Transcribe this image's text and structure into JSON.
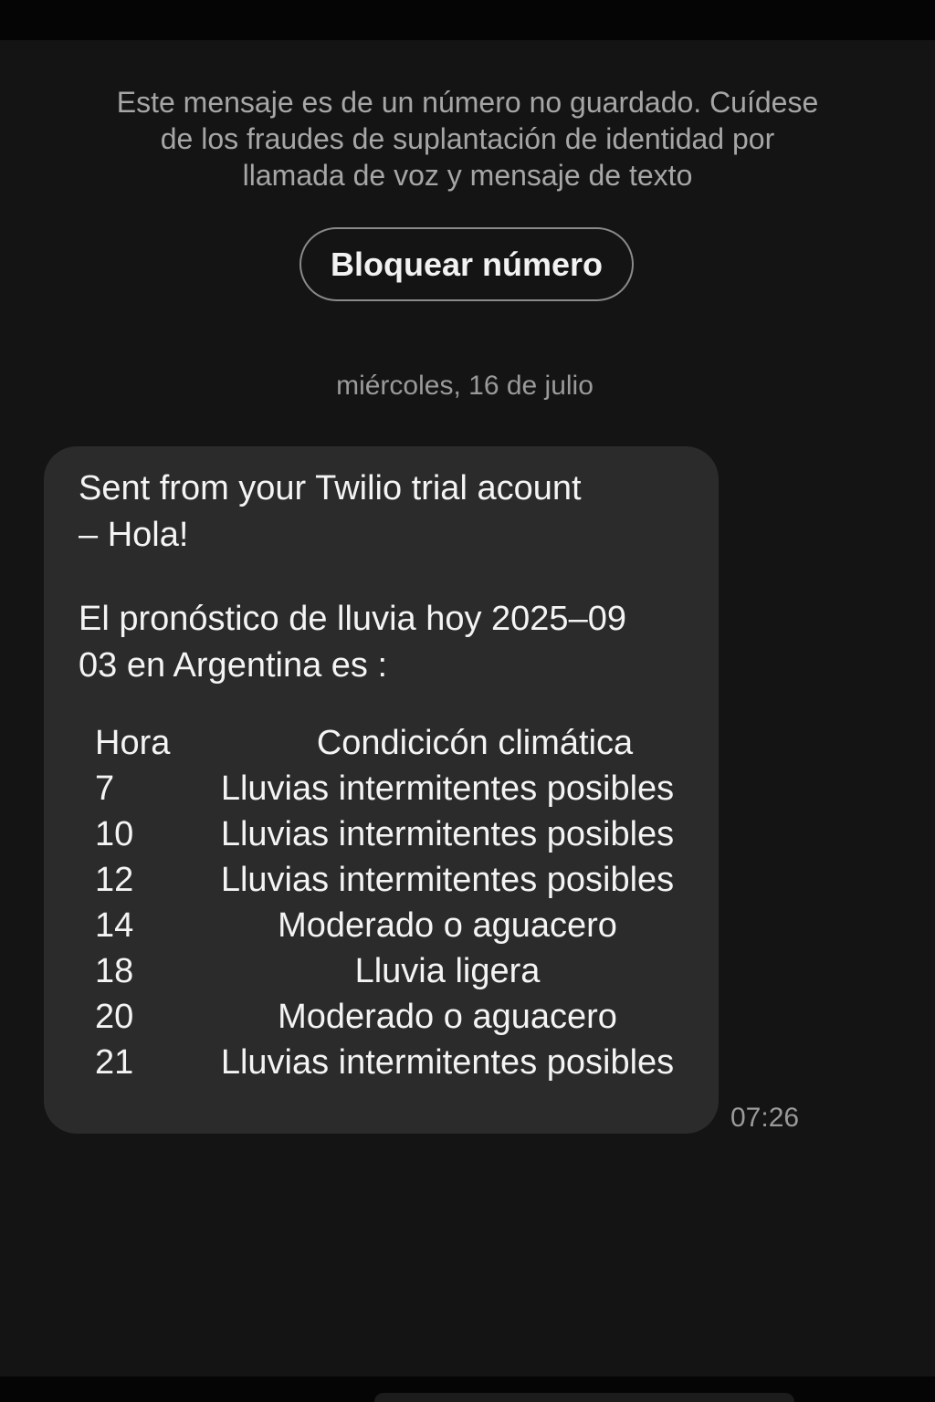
{
  "security_notice": {
    "line1": "Este mensaje es de un número no guardado. Cuídese",
    "line2": "de los fraudes de suplantación de identidad por",
    "line3": "llamada de voz y mensaje de texto"
  },
  "block_button_label": "Bloquear número",
  "date_separator": "miércoles, 16 de julio",
  "message": {
    "line1": "Sent from your Twilio trial acount",
    "line2": "– Hola!",
    "line3": "El pronóstico de lluvia hoy 2025–09",
    "line4": "03 en Argentina es :",
    "table": {
      "header_hour": "Hora",
      "header_condition": "Condicicón climática",
      "rows": [
        {
          "hour": "7",
          "condition": "Lluvias intermitentes posibles"
        },
        {
          "hour": "10",
          "condition": "Lluvias intermitentes posibles"
        },
        {
          "hour": "12",
          "condition": "Lluvias intermitentes posibles"
        },
        {
          "hour": "14",
          "condition": "Moderado o aguacero"
        },
        {
          "hour": "18",
          "condition": "Lluvia ligera"
        },
        {
          "hour": "20",
          "condition": "Moderado o aguacero"
        },
        {
          "hour": "21",
          "condition": "Lluvias intermitentes posibles"
        }
      ]
    },
    "time": "07:26"
  }
}
